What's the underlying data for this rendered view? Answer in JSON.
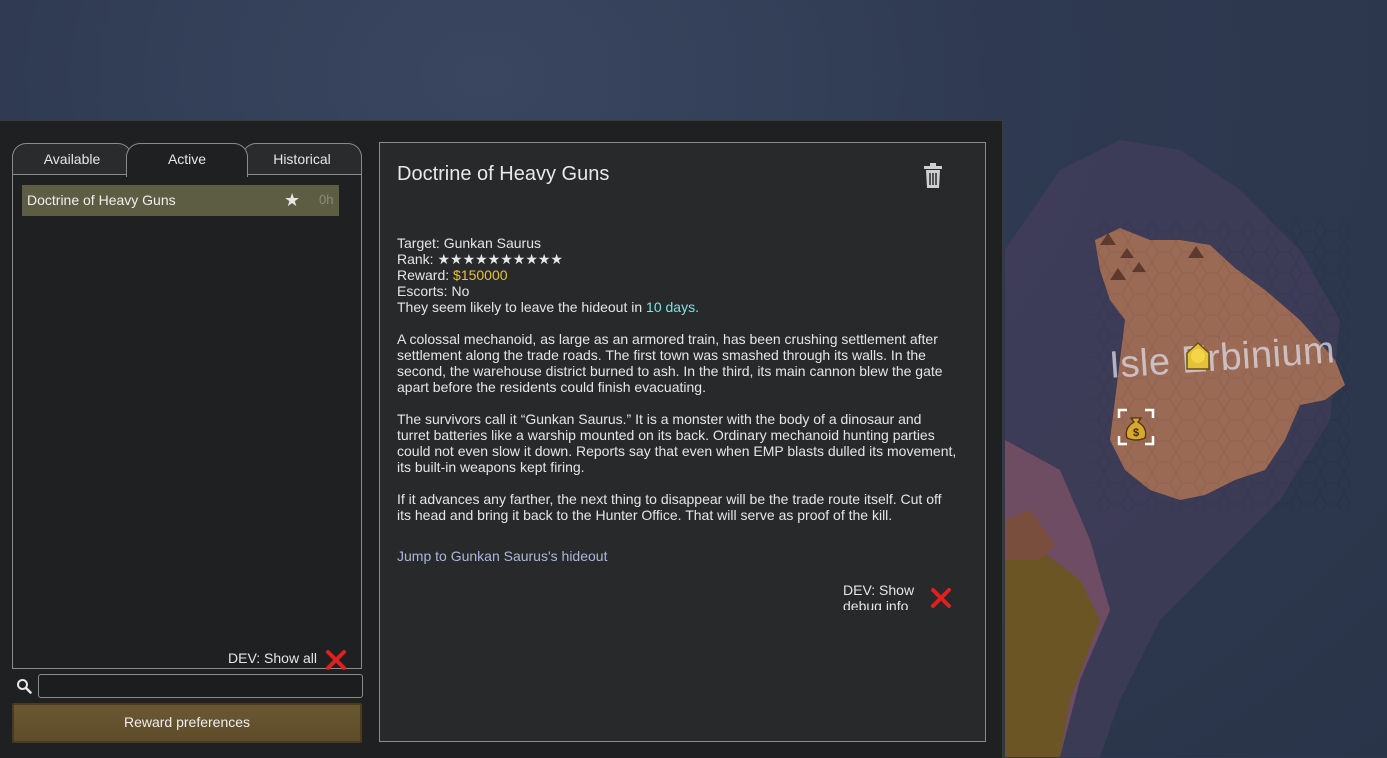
{
  "map": {
    "island_label": "Isle Erbinium"
  },
  "tabs": [
    {
      "label": "Available"
    },
    {
      "label": "Active"
    },
    {
      "label": "Historical"
    }
  ],
  "list": {
    "items": [
      {
        "name": "Doctrine of Heavy Guns",
        "time": "0h",
        "icon": "star-icon"
      }
    ],
    "dev_show_all": "DEV: Show all"
  },
  "search": {
    "value": "",
    "placeholder": ""
  },
  "reward_button": "Reward preferences",
  "detail": {
    "title": "Doctrine of Heavy Guns",
    "target_label": "Target: ",
    "target_value": "Gunkan Saurus",
    "rank_label": "Rank: ",
    "rank_value": "★★★★★★★★★★",
    "reward_label": "Reward: ",
    "reward_value": "$150000",
    "escorts_label": "Escorts: ",
    "escorts_value": "No",
    "leave_prefix": "They seem likely to leave the hideout in ",
    "leave_days": "10 days",
    "leave_suffix": ".",
    "para1": "A colossal mechanoid, as large as an armored train, has been crushing settlement after settlement along the trade roads. The first town was smashed through its walls. In the second, the warehouse district burned to ash. In the third, its main cannon blew the gate apart before the residents could finish evacuating.",
    "para2": "The survivors call it “Gunkan Saurus.” It is a monster with the body of a dinosaur and turret batteries like a warship mounted on its back. Ordinary mechanoid hunting parties could not even slow it down. Reports say that even when EMP blasts dulled its movement, its built-in weapons kept firing.",
    "para3": "If it advances any farther, the next thing to disappear will be the trade route itself. Cut off its head and bring it back to the Hunter Office. That will serve as proof of the kill.",
    "jump_link": "Jump to Gunkan Saurus's hideout",
    "dev_debug": "DEV: Show debug info"
  },
  "colors": {
    "reward": "#e8c232",
    "days": "#7fe3e3",
    "link": "#a8b9d8",
    "toggle_off": "#e02020"
  }
}
